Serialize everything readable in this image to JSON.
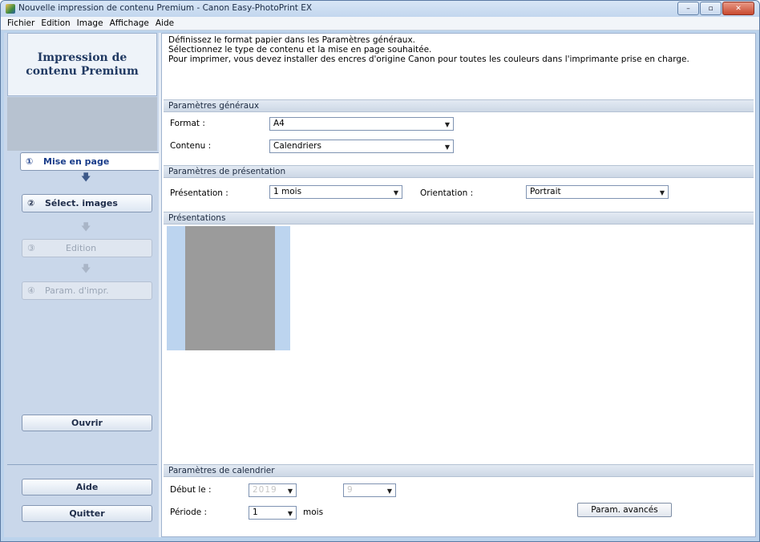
{
  "window": {
    "title": "Nouvelle impression de contenu Premium - Canon Easy-PhotoPrint EX",
    "btn_min": "–",
    "btn_max": "▫",
    "btn_close": "✕"
  },
  "menu": [
    "Fichier",
    "Edition",
    "Image",
    "Affichage",
    "Aide"
  ],
  "sidebar": {
    "header": "Impression de contenu Premium",
    "steps": [
      {
        "num": "①",
        "label": "Mise en page"
      },
      {
        "num": "②",
        "label": "Sélect. images"
      },
      {
        "num": "③",
        "label": "Edition"
      },
      {
        "num": "④",
        "label": "Param. d'impr."
      }
    ],
    "arrow": "🡇",
    "open": "Ouvrir",
    "help": "Aide",
    "quit": "Quitter"
  },
  "info": [
    "Définissez le format papier dans les Paramètres généraux.",
    "Sélectionnez le type de contenu et la mise en page souhaitée.",
    "Pour imprimer, vous devez installer des encres d'origine Canon pour toutes les couleurs dans l'imprimante prise en charge."
  ],
  "general": {
    "heading": "Paramètres généraux",
    "format_label": "Format :",
    "format_value": "A4",
    "content_label": "Contenu :",
    "content_value": "Calendriers"
  },
  "presentation_settings": {
    "heading": "Paramètres de présentation",
    "presentation_label": "Présentation :",
    "presentation_value": "1 mois",
    "orientation_label": "Orientation :",
    "orientation_value": "Portrait"
  },
  "layouts": {
    "heading": "Présentations"
  },
  "calendar": {
    "heading": "Paramètres de calendrier",
    "start_label": "Début le :",
    "start_year": "2019",
    "start_month": "9",
    "period_label": "Période :",
    "period_value": "1",
    "period_unit": "mois",
    "advanced_button": "Param. avancés"
  },
  "colors": {
    "accent": "#1a3d8a",
    "thumb_bg": "#bcd4ef",
    "page_gray": "#9b9b9b"
  }
}
